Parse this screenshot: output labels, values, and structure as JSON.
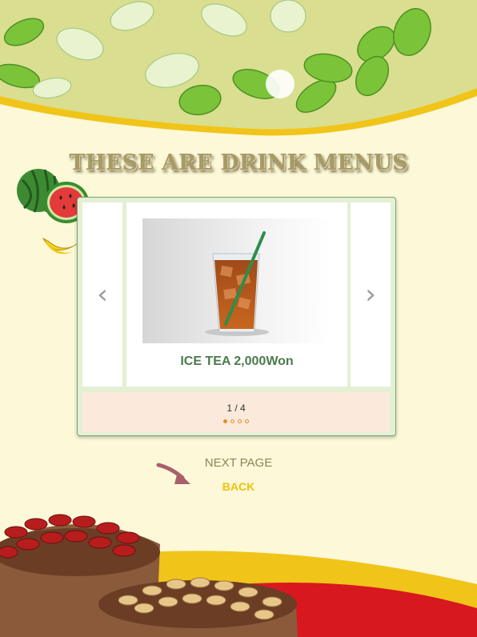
{
  "page": {
    "heading": "THESE ARE DRINK MENUS"
  },
  "carousel": {
    "prev_symbol": "‹",
    "next_symbol": "›",
    "current_item": {
      "name": "ICE TEA 2,000Won",
      "image": "iced-tea-glass"
    },
    "pager_text": "1 / 4",
    "total_pages": 4,
    "current_page": 1
  },
  "nav": {
    "next_page_label": "NEXT PAGE",
    "back_label": "BACK"
  },
  "colors": {
    "background": "#fcf8d8",
    "heading": "#a69a66",
    "caption": "#4b7a4c",
    "back_link": "#f0c20a",
    "dot_active": "#e98c22"
  }
}
